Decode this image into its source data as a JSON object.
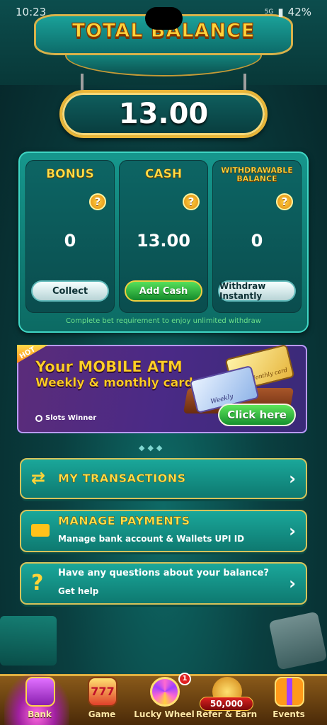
{
  "status_bar": {
    "time": "10:23",
    "battery": "42%",
    "network": "5G"
  },
  "header": {
    "title": "TOTAL BALANCE",
    "total_amount": "13.00"
  },
  "balances": [
    {
      "title": "BONUS",
      "value": "0",
      "button": "Collect"
    },
    {
      "title": "CASH",
      "value": "13.00",
      "button": "Add Cash"
    },
    {
      "title_line1": "WITHDRAWABLE",
      "title_line2": "BALANCE",
      "value": "0",
      "button": "Withdraw Instantly"
    }
  ],
  "balance_note": "Complete bet requirement to enjoy unlimited withdraw",
  "promo": {
    "tag": "HOT",
    "line1": "Your MOBILE ATM",
    "line2": "Weekly & monthly card",
    "brand": "Slots Winner",
    "card_monthly": "Monthly card",
    "card_weekly": "Weekly",
    "cta": "Click here"
  },
  "menu": {
    "transactions": {
      "title": "MY TRANSACTIONS"
    },
    "payments": {
      "title": "MANAGE PAYMENTS",
      "subtitle": "Manage bank account & Wallets UPI ID"
    },
    "help": {
      "title": "Have any questions about your balance?",
      "subtitle": "Get help"
    }
  },
  "bottom_nav": [
    {
      "label": "Bank",
      "icon": "bank-icon"
    },
    {
      "label": "Game",
      "icon": "slot-777-icon"
    },
    {
      "label": "Lucky Wheel",
      "icon": "wheel-icon",
      "badge": "1"
    },
    {
      "label": "Refer & Earn",
      "icon": "refer-icon",
      "coins": "50,000"
    },
    {
      "label": "Events",
      "icon": "gift-icon"
    }
  ],
  "colors": {
    "accent_gold": "#ffd43b",
    "panel_teal": "#16978d",
    "button_green": "#2db83e",
    "promo_purple": "#4a2a86"
  }
}
